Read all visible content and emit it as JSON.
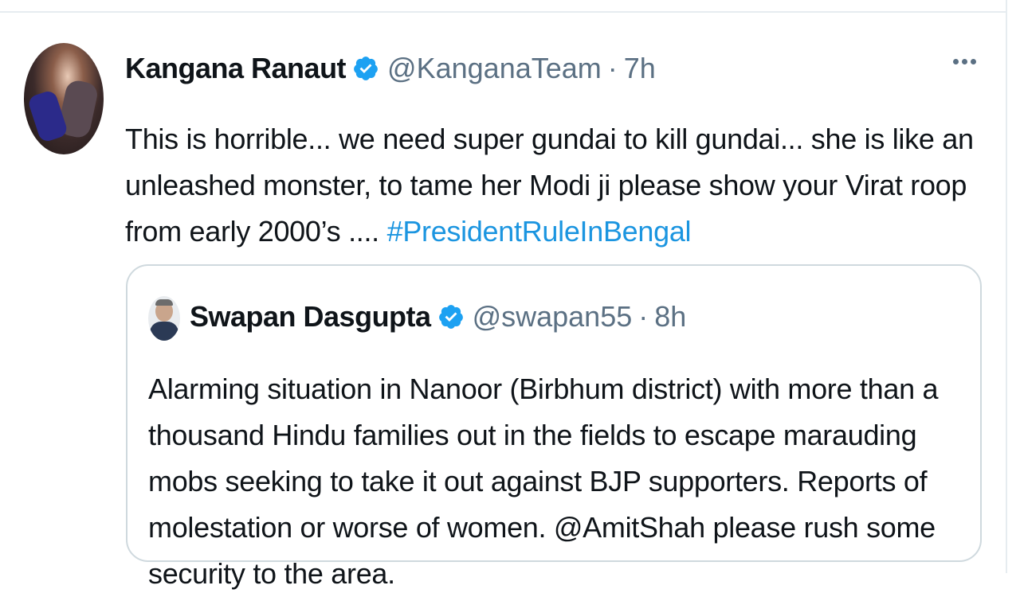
{
  "tweet": {
    "author_name": "Kangana Ranaut",
    "handle": "@KanganaTeam",
    "separator": "·",
    "time": "7h",
    "text": "This is horrible... we need super gundai to kill gundai... she is like an unleashed monster, to tame her Modi ji please show your Virat roop from early 2000’s .... ",
    "hashtag": "#PresidentRuleInBengal",
    "more_icon": "more-horizontal-icon"
  },
  "quoted": {
    "author_name": "Swapan Dasgupta",
    "handle": "@swapan55",
    "separator": "·",
    "time": "8h",
    "text": "Alarming situation in Nanoor (Birbhum district) with more than a thousand Hindu families out in the fields to escape marauding mobs seeking to take it out against BJP supporters. Reports of molestation or worse of women. @AmitShah please rush some security to the area."
  },
  "colors": {
    "accent": "#1b95e0",
    "muted": "#5b7083",
    "border": "#cfd9de"
  }
}
